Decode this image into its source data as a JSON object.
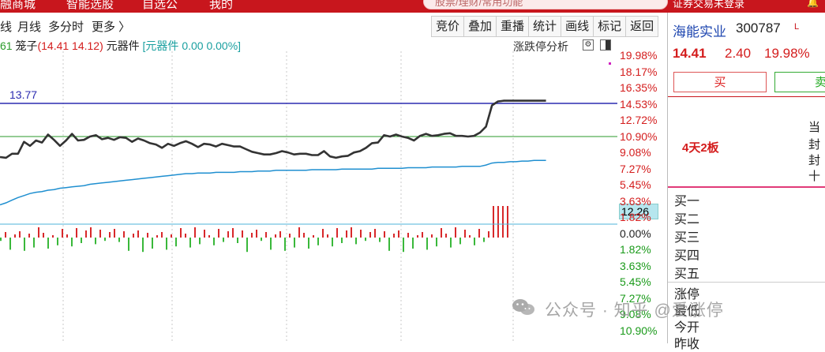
{
  "top_nav": {
    "items": [
      "融商城",
      "智能选股",
      "自选公",
      "我的"
    ],
    "search_placeholder": "股票/理财/常用功能",
    "login_text": "证券交易未登录",
    "bell_icon": "bell-icon"
  },
  "period_bar": {
    "items": [
      "线",
      "月线",
      "多分时",
      "更多 〉"
    ]
  },
  "toolbar": {
    "items": [
      "竞价",
      "叠加",
      "重播",
      "统计",
      "画线",
      "标记",
      "返回"
    ]
  },
  "info_line": {
    "prefix": "61",
    "cage_label": "笼子",
    "cage_values": "(14.41 14.12)",
    "component_label": "元器件",
    "component_values": "[元器件 0.00 0.00%]",
    "limit_analysis": "涨跌停分析",
    "settings_icon": "gear-icon",
    "layout_icon": "panel-toggle-icon"
  },
  "chart": {
    "line_label": "13.77",
    "current_price_label": "12.26",
    "y_ticks": [
      {
        "label": "19.98%",
        "color": "#d41d1d"
      },
      {
        "label": "18.17%",
        "color": "#d41d1d"
      },
      {
        "label": "16.35%",
        "color": "#d41d1d"
      },
      {
        "label": "14.53%",
        "color": "#d41d1d"
      },
      {
        "label": "12.72%",
        "color": "#d41d1d"
      },
      {
        "label": "10.90%",
        "color": "#d41d1d"
      },
      {
        "label": "9.08%",
        "color": "#d41d1d"
      },
      {
        "label": "7.27%",
        "color": "#d41d1d"
      },
      {
        "label": "5.45%",
        "color": "#d41d1d"
      },
      {
        "label": "3.63%",
        "color": "#d41d1d"
      },
      {
        "label": "1.82%",
        "color": "#d41d1d"
      },
      {
        "label": "0.00%",
        "color": "#222222"
      },
      {
        "label": "1.82%",
        "color": "#1a9a1a"
      },
      {
        "label": "3.63%",
        "color": "#1a9a1a"
      },
      {
        "label": "5.45%",
        "color": "#1a9a1a"
      },
      {
        "label": "7.27%",
        "color": "#1a9a1a"
      },
      {
        "label": "9.08%",
        "color": "#1a9a1a"
      },
      {
        "label": "10.90%",
        "color": "#1a9a1a"
      }
    ],
    "price_series": [
      9.4,
      9.3,
      9.9,
      9.9,
      11.7,
      11.1,
      11.9,
      11.6,
      12.8,
      12.0,
      11.1,
      11.9,
      12.9,
      11.9,
      12.0,
      12.5,
      12.7,
      12.1,
      12.3,
      12.0,
      12.4,
      12.3,
      11.7,
      12.2,
      11.9,
      11.5,
      11.3,
      10.8,
      11.4,
      11.1,
      11.5,
      11.8,
      11.4,
      10.9,
      11.4,
      11.3,
      11.0,
      11.4,
      11.2,
      11.0,
      11.0,
      10.6,
      10.2,
      10.0,
      9.8,
      9.8,
      10.0,
      10.3,
      10.1,
      9.8,
      9.9,
      9.9,
      9.7,
      9.7,
      10.3,
      9.5,
      9.3,
      9.5,
      9.6,
      10.1,
      10.3,
      10.8,
      11.5,
      11.6,
      12.7,
      12.5,
      12.8,
      12.5,
      12.3,
      11.9,
      12.6,
      12.9,
      12.6,
      12.7,
      12.9,
      13.0,
      12.6,
      12.6,
      12.5,
      12.6,
      13.1,
      14.0,
      17.2,
      17.8,
      17.9,
      17.9,
      17.9,
      17.9,
      17.9,
      17.9,
      17.9,
      17.9
    ],
    "avg_series": [
      2.2,
      2.5,
      2.9,
      3.3,
      3.6,
      3.9,
      4.1,
      4.2,
      4.4,
      4.5,
      4.7,
      4.8,
      4.9,
      5.0,
      5.1,
      5.3,
      5.4,
      5.5,
      5.6,
      5.7,
      5.8,
      5.9,
      6.0,
      6.1,
      6.2,
      6.3,
      6.4,
      6.5,
      6.6,
      6.7,
      6.8,
      6.9,
      6.9,
      7.0,
      7.0,
      7.0,
      7.1,
      7.1,
      7.1,
      7.1,
      7.2,
      7.2,
      7.2,
      7.3,
      7.3,
      7.3,
      7.4,
      7.4,
      7.4,
      7.4,
      7.4,
      7.4,
      7.5,
      7.5,
      7.5,
      7.5,
      7.5,
      7.6,
      7.6,
      7.6,
      7.6,
      7.6,
      7.6,
      7.7,
      7.7,
      7.7,
      7.7,
      7.7,
      7.8,
      7.8,
      7.8,
      7.8,
      7.9,
      7.9,
      7.9,
      7.9,
      7.9,
      8.0,
      8.0,
      8.0,
      8.0,
      8.2,
      8.5,
      8.6,
      8.6,
      8.7,
      8.7,
      8.8,
      8.8,
      8.9,
      8.9,
      8.9
    ]
  },
  "right_panel": {
    "stock_name": "海能实业",
    "stock_code": "300787",
    "flag": "L",
    "price": "14.41",
    "change": "2.40",
    "change_pct": "19.98%",
    "buy_label": "买",
    "sell_label": "卖",
    "board_tag": "4天2板",
    "seal_labels": [
      "当",
      "封",
      "封",
      "十"
    ],
    "order_book": [
      "买一",
      "买二",
      "买三",
      "买四",
      "买五",
      "涨停",
      "最低",
      "今开",
      "昨收"
    ]
  },
  "watermark": {
    "text": "公众号 · 知乎 @爱涨停",
    "logo_icon": "wechat-logo-icon"
  }
}
